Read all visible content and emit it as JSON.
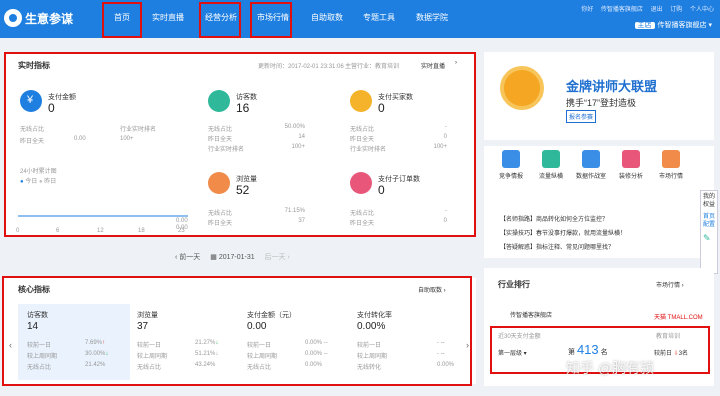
{
  "header": {
    "brand": "生意参谋",
    "nav": [
      "首页",
      "实时直播",
      "经营分析",
      "市场行情",
      "自助取数",
      "专题工具",
      "数据学院"
    ],
    "links": [
      "你好",
      "传智播客旗舰店",
      "退出",
      "订购",
      "个人中心"
    ],
    "shop_tag": "主店",
    "shop_name": "传智播客旗舰店"
  },
  "realtime": {
    "title": "实时指标",
    "update": "更新时间：2017-02-01 23:31:06",
    "industry": "主营行业：教育培训",
    "live": "实时直播",
    "pay": {
      "label": "支付金额",
      "value": "0",
      "r1": "无线占比",
      "r2": "昨日全天",
      "r2v": "0.00",
      "r3": "行业实时排名",
      "r3v": "100+"
    },
    "visitors": {
      "label": "访客数",
      "value": "16",
      "r1": "无线占比",
      "r1v": "50.00%",
      "r2": "昨日全天",
      "r2v": "14",
      "r3": "行业实时排名",
      "r3v": "100+"
    },
    "buyers": {
      "label": "支付买家数",
      "value": "0",
      "r1": "无线占比",
      "r1v": "-",
      "r2": "昨日全天",
      "r2v": "0",
      "r3": "行业实时排名",
      "r3v": "100+"
    },
    "pv": {
      "label": "浏览量",
      "value": "52",
      "r1": "无线占比",
      "r1v": "71.15%",
      "r2": "昨日全天",
      "r2v": "37"
    },
    "orders": {
      "label": "支付子订单数",
      "value": "0",
      "r1": "无线占比",
      "r1v": "-",
      "r2": "昨日全天",
      "r2v": "0"
    },
    "chart": {
      "title": "24小时累计图",
      "legend_today": "今日",
      "legend_yday": "昨日",
      "ticks": [
        "0",
        "6",
        "12",
        "18",
        "23"
      ],
      "ymax": "0.00",
      "ymin": "0.00"
    }
  },
  "datenav": {
    "prev": "前一天",
    "date": "2017-01-31",
    "next": "后一天"
  },
  "core": {
    "title": "核心指标",
    "custom": "自助取数",
    "cols": [
      {
        "t": "访客数",
        "v": "14",
        "a": "较前一日",
        "av": "7.69%",
        "b": "较上周同期",
        "bv": "30.00%",
        "c": "无线占比",
        "cv": "21.42%"
      },
      {
        "t": "浏览量",
        "v": "37",
        "a": "较前一日",
        "av": "21.27%",
        "b": "较上周同期",
        "bv": "51.21%",
        "c": "无线占比",
        "cv": "43.24%"
      },
      {
        "t": "支付金额（元）",
        "v": "0.00",
        "a": "较前一日",
        "av": "0.00% --",
        "b": "较上周同期",
        "bv": "0.00% --",
        "c": "无线占比",
        "cv": "0.00%"
      },
      {
        "t": "支付转化率",
        "v": "0.00%",
        "a": "较前一日",
        "av": "- --",
        "b": "较上周同期",
        "bv": "- --",
        "c": "无线转化",
        "cv": "0.00%"
      }
    ]
  },
  "banner": {
    "title": "金牌讲师大联盟",
    "sub": "携手“17”登封造极",
    "btn": "报名参赛"
  },
  "tools": {
    "items": [
      "竞争情报",
      "流量纵横",
      "数据作战室",
      "装修分析",
      "市场行情"
    ],
    "tips": [
      "【名师指路】商品转化如何全方位监控？",
      "【实操技巧】春节没事打爆款，就用流量纵横！",
      "【答疑解惑】指标注释、常见问题哪里找？"
    ]
  },
  "rank": {
    "title": "行业排行",
    "market": "市场行情",
    "store": "传智播客旗舰店",
    "tmall": "天猫 TMALL.COM",
    "label": "近30天支付金额",
    "industry": "教育培训",
    "tier": "第一层级",
    "place_pre": "第",
    "place": "413",
    "place_suf": "名",
    "prev": "较前日",
    "change": "3名"
  },
  "side": {
    "items": [
      "我的权益",
      "首页配置"
    ]
  },
  "watermark": "知乎 @胸有颍"
}
